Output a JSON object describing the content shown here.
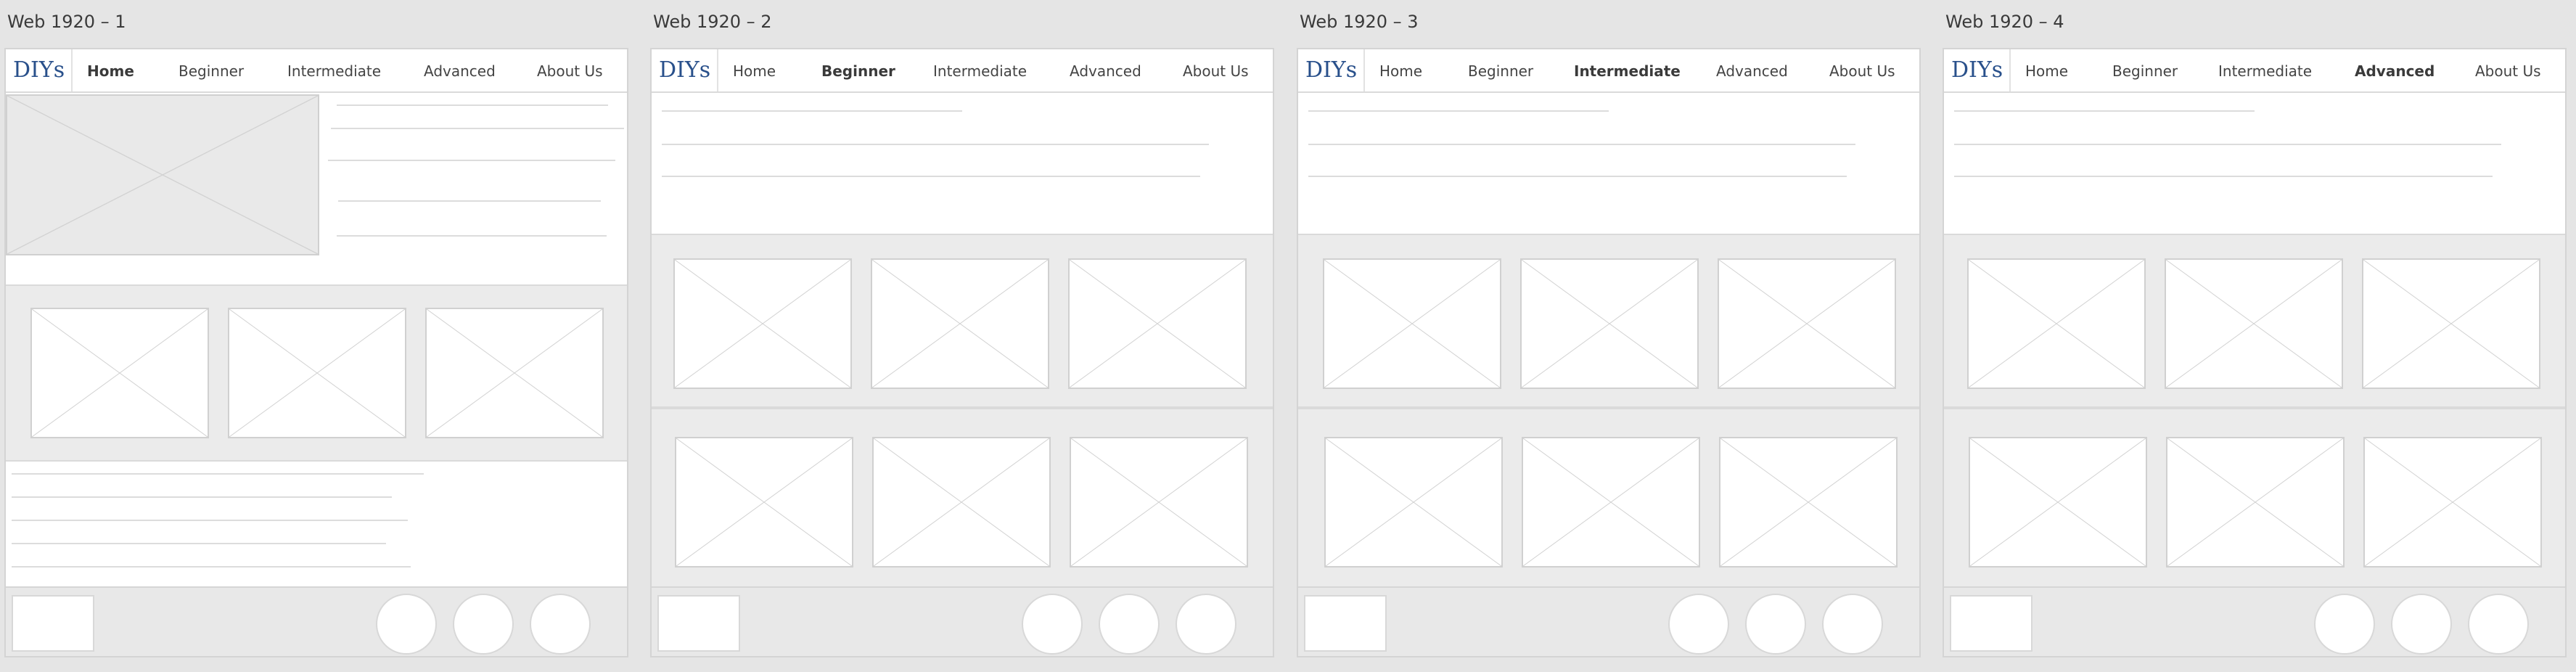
{
  "artboards": [
    {
      "title": "Web 1920 – 1"
    },
    {
      "title": "Web 1920 – 2"
    },
    {
      "title": "Web 1920 – 3"
    },
    {
      "title": "Web 1920 – 4"
    }
  ],
  "nav": {
    "logo": "DIYs",
    "items": [
      "Home",
      "Beginner",
      "Intermediate",
      "Advanced",
      "About Us"
    ]
  },
  "active_nav_item": [
    "Home",
    "Beginner",
    "Intermediate",
    "Advanced"
  ]
}
